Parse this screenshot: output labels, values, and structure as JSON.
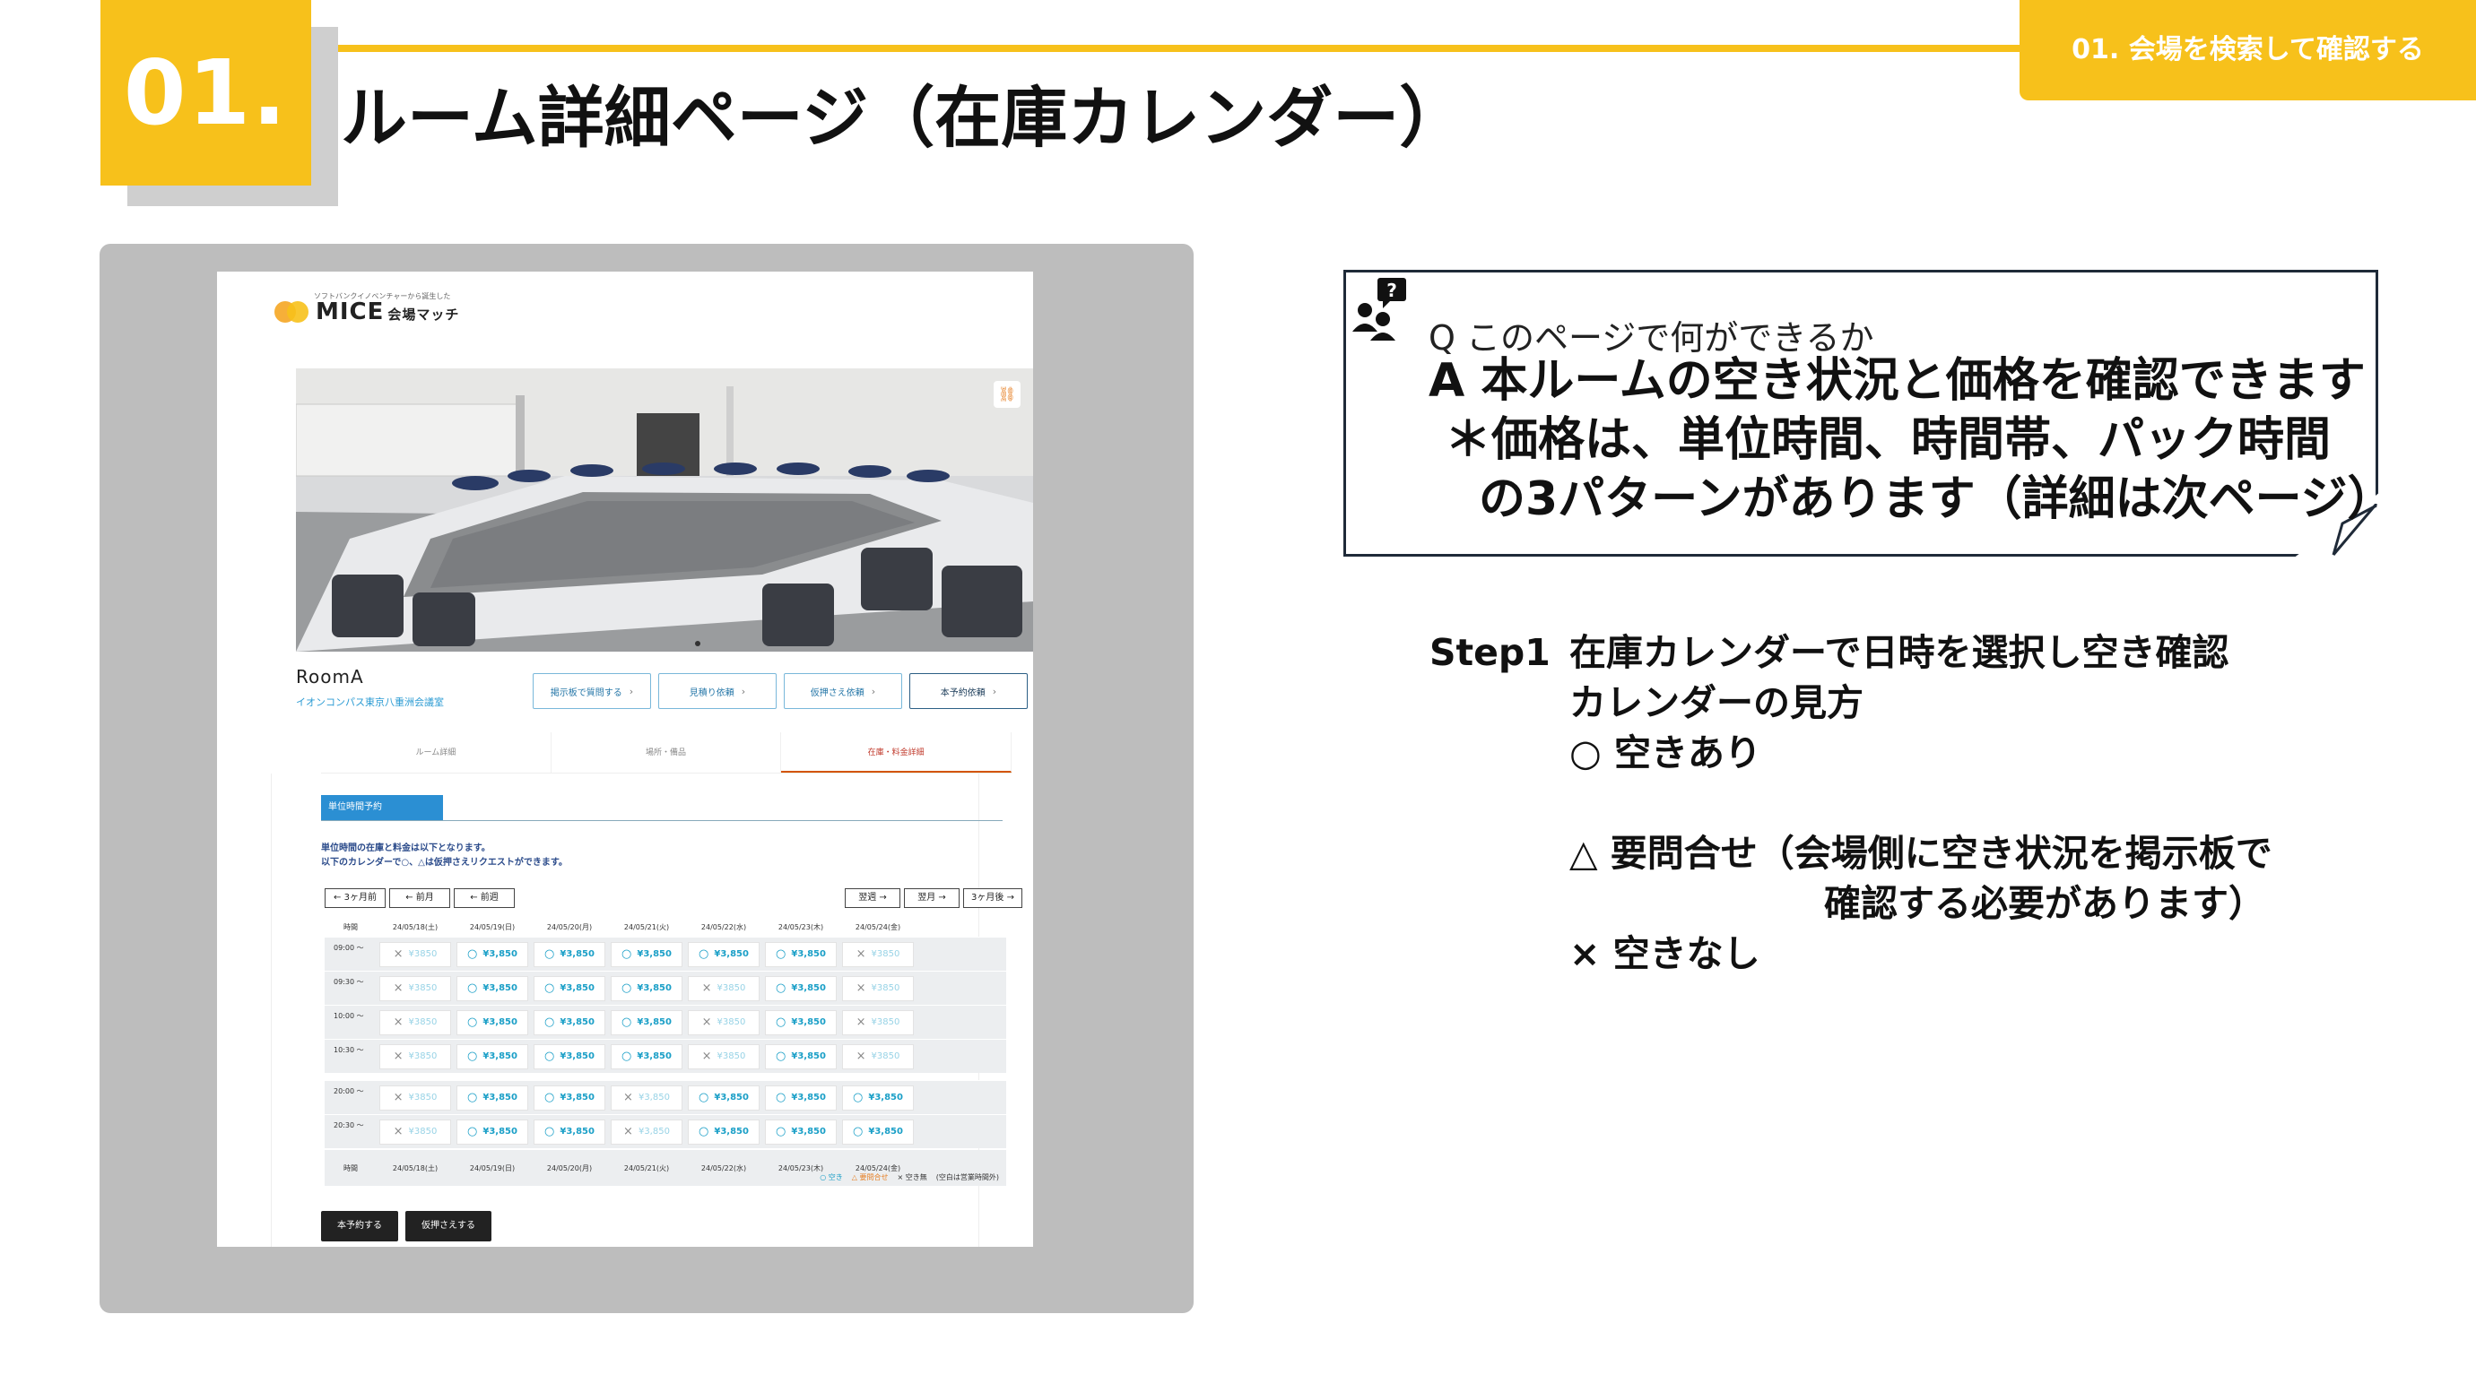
{
  "slide": {
    "number": "01.",
    "title": "ルーム詳細ページ（在庫カレンダー）",
    "section_tag": "01. 会場を検索して確認する"
  },
  "screenshot": {
    "logo_subtitle": "ソフトバンクイノベンチャーから誕生した",
    "logo_text": "MICE",
    "logo_suffix": "会場マッチ",
    "room_name": "RoomA",
    "venue_name": "イオンコンパス東京八重洲会議室",
    "actions": [
      "掲示板で質問する",
      "見積り依頼",
      "仮押さえ依頼",
      "本予約依頼"
    ],
    "tabs": [
      "ルーム詳細",
      "場所・備品",
      "在庫・料金詳細"
    ],
    "section_header": "単位時間予約",
    "note_lines": [
      "単位時間の在庫と料金は以下となります。",
      "以下のカレンダーで○、△は仮押さえリクエストができます。"
    ],
    "nav_prev": [
      "← 3ヶ月前",
      "← 前月",
      "← 前週"
    ],
    "nav_next": [
      "翌週 →",
      "翌月 →",
      "3ヶ月後 →"
    ],
    "time_header": "時間",
    "dates": [
      "24/05/18(土)",
      "24/05/19(日)",
      "24/05/20(月)",
      "24/05/21(火)",
      "24/05/22(水)",
      "24/05/23(木)",
      "24/05/24(金)"
    ],
    "rows": [
      {
        "time": "09:00 〜",
        "slots": [
          [
            "×",
            "¥3850"
          ],
          [
            "○",
            "¥3,850"
          ],
          [
            "○",
            "¥3,850"
          ],
          [
            "○",
            "¥3,850"
          ],
          [
            "○",
            "¥3,850"
          ],
          [
            "○",
            "¥3,850"
          ],
          [
            "×",
            "¥3850"
          ]
        ]
      },
      {
        "time": "09:30 〜",
        "slots": [
          [
            "×",
            "¥3850"
          ],
          [
            "○",
            "¥3,850"
          ],
          [
            "○",
            "¥3,850"
          ],
          [
            "○",
            "¥3,850"
          ],
          [
            "×",
            "¥3850"
          ],
          [
            "○",
            "¥3,850"
          ],
          [
            "×",
            "¥3850"
          ]
        ]
      },
      {
        "time": "10:00 〜",
        "slots": [
          [
            "×",
            "¥3850"
          ],
          [
            "○",
            "¥3,850"
          ],
          [
            "○",
            "¥3,850"
          ],
          [
            "○",
            "¥3,850"
          ],
          [
            "×",
            "¥3850"
          ],
          [
            "○",
            "¥3,850"
          ],
          [
            "×",
            "¥3850"
          ]
        ]
      },
      {
        "time": "10:30 〜",
        "slots": [
          [
            "×",
            "¥3850"
          ],
          [
            "○",
            "¥3,850"
          ],
          [
            "○",
            "¥3,850"
          ],
          [
            "○",
            "¥3,850"
          ],
          [
            "×",
            "¥3850"
          ],
          [
            "○",
            "¥3,850"
          ],
          [
            "×",
            "¥3850"
          ]
        ]
      },
      {
        "time": "20:00 〜",
        "slots": [
          [
            "×",
            "¥3850"
          ],
          [
            "○",
            "¥3,850"
          ],
          [
            "○",
            "¥3,850"
          ],
          [
            "×",
            "¥3,850"
          ],
          [
            "○",
            "¥3,850"
          ],
          [
            "○",
            "¥3,850"
          ],
          [
            "○",
            "¥3,850"
          ]
        ]
      },
      {
        "time": "20:30 〜",
        "slots": [
          [
            "×",
            "¥3850"
          ],
          [
            "○",
            "¥3,850"
          ],
          [
            "○",
            "¥3,850"
          ],
          [
            "×",
            "¥3,850"
          ],
          [
            "○",
            "¥3,850"
          ],
          [
            "○",
            "¥3,850"
          ],
          [
            "○",
            "¥3,850"
          ]
        ]
      }
    ],
    "legend": [
      "○ 空き",
      "△ 要問合せ",
      "× 空き無",
      "(空白は営業時間外)"
    ],
    "bottom_buttons": [
      "本予約する",
      "仮押さえする"
    ]
  },
  "qa": {
    "question": "Q このページで何ができるか",
    "answer": "A 本ルームの空き状況と価格を確認できます",
    "answer_line2": "＊価格は、単位時間、時間帯、パック時間",
    "answer_line3": "の3パターンがあります（詳細は次ページ）"
  },
  "steps": {
    "label": "Step1",
    "line1": "在庫カレンダーで日時を選択し空き確認",
    "line2": "カレンダーの見方",
    "line3": "○ 空きあり",
    "line4": "△ 要問合せ（会場側に空き状況を掲示板で",
    "line5": "確認する必要があります）",
    "line6": "×  空きなし"
  },
  "colors": {
    "accent": "#f7c11b",
    "panel": "#bdbdbd",
    "link": "#2b9bd3",
    "available": "#1a9fc7"
  }
}
